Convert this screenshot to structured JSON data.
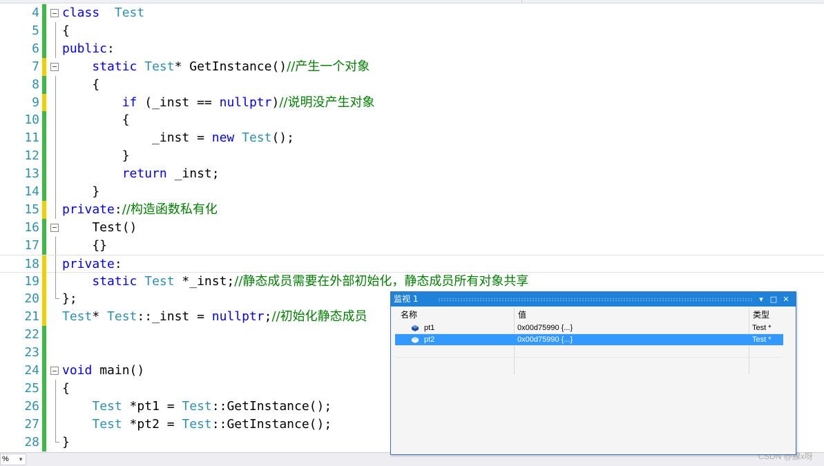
{
  "editor": {
    "lines": [
      {
        "n": "4",
        "bar": "green",
        "fold": true,
        "segs": [
          [
            "kw",
            "class"
          ],
          [
            "",
            "  "
          ],
          [
            "ty",
            "Test"
          ]
        ]
      },
      {
        "n": "5",
        "bar": "green",
        "guide": true,
        "segs": [
          [
            "",
            "{"
          ]
        ]
      },
      {
        "n": "6",
        "bar": "green",
        "guide": true,
        "segs": [
          [
            "kw",
            "public"
          ],
          [
            "",
            ":"
          ]
        ]
      },
      {
        "n": "7",
        "bar": "yellow",
        "fold": true,
        "segs": [
          [
            "",
            "    "
          ],
          [
            "kw",
            "static"
          ],
          [
            "",
            ""
          ],
          [
            "ty",
            " Test"
          ],
          [
            "",
            "* GetInstance()"
          ],
          [
            "cm",
            "//产生一个对象"
          ]
        ]
      },
      {
        "n": "8",
        "bar": "green",
        "guide": true,
        "segs": [
          [
            "",
            "    {"
          ]
        ]
      },
      {
        "n": "9",
        "bar": "yellow",
        "guide": true,
        "segs": [
          [
            "",
            "        "
          ],
          [
            "kw",
            "if"
          ],
          [
            "",
            " (_inst == "
          ],
          [
            "kw",
            "nullptr"
          ],
          [
            "",
            ")"
          ],
          [
            "cm",
            "//说明没产生对象"
          ]
        ]
      },
      {
        "n": "10",
        "bar": "green",
        "guide": true,
        "segs": [
          [
            "",
            "        {"
          ]
        ]
      },
      {
        "n": "11",
        "bar": "green",
        "guide": true,
        "segs": [
          [
            "",
            "            _inst = "
          ],
          [
            "kw",
            "new"
          ],
          [
            "ty",
            " Test"
          ],
          [
            "",
            "();"
          ]
        ]
      },
      {
        "n": "12",
        "bar": "green",
        "guide": true,
        "segs": [
          [
            "",
            "        }"
          ]
        ]
      },
      {
        "n": "13",
        "bar": "green",
        "guide": true,
        "segs": [
          [
            "",
            "        "
          ],
          [
            "kw",
            "return"
          ],
          [
            "",
            " _inst;"
          ]
        ]
      },
      {
        "n": "14",
        "bar": "green",
        "guide": true,
        "segs": [
          [
            "",
            "    }"
          ]
        ]
      },
      {
        "n": "15",
        "bar": "yellow",
        "guide": true,
        "segs": [
          [
            "kw",
            "private"
          ],
          [
            "",
            ":"
          ],
          [
            "cm",
            "//构造函数私有化"
          ]
        ]
      },
      {
        "n": "16",
        "bar": "green",
        "fold": true,
        "segs": [
          [
            "",
            "    Test()"
          ]
        ]
      },
      {
        "n": "17",
        "bar": "green",
        "guide": true,
        "segs": [
          [
            "",
            "    {}"
          ]
        ]
      },
      {
        "n": "18",
        "bar": "yellow",
        "guide": true,
        "current": true,
        "segs": [
          [
            "kw",
            "private"
          ],
          [
            "",
            ":"
          ]
        ]
      },
      {
        "n": "19",
        "bar": "yellow",
        "guide": true,
        "segs": [
          [
            "",
            "    "
          ],
          [
            "kw",
            "static"
          ],
          [
            "ty",
            " Test"
          ],
          [
            "",
            " *_inst;"
          ],
          [
            "cm",
            "//静态成员需要在外部初始化，静态成员所有对象共享"
          ]
        ]
      },
      {
        "n": "20",
        "bar": "yellow",
        "guideEnd": true,
        "segs": [
          [
            "",
            "};"
          ]
        ]
      },
      {
        "n": "21",
        "bar": "yellow",
        "segs": [
          [
            "ty",
            "Test"
          ],
          [
            "",
            "* "
          ],
          [
            "ty",
            "Test"
          ],
          [
            "",
            "::_inst = "
          ],
          [
            "kw",
            "nullptr"
          ],
          [
            "",
            ";"
          ],
          [
            "cm",
            "//初始化静态成员"
          ]
        ]
      },
      {
        "n": "22",
        "bar": "green",
        "segs": []
      },
      {
        "n": "23",
        "bar": "green",
        "segs": []
      },
      {
        "n": "24",
        "bar": "green",
        "fold": true,
        "segs": [
          [
            "kw",
            "void"
          ],
          [
            "",
            " main()"
          ]
        ]
      },
      {
        "n": "25",
        "bar": "green",
        "guide": true,
        "segs": [
          [
            "",
            "{"
          ]
        ]
      },
      {
        "n": "26",
        "bar": "green",
        "guide": true,
        "segs": [
          [
            "",
            "    "
          ],
          [
            "ty",
            "Test"
          ],
          [
            "",
            " *pt1 = "
          ],
          [
            "ty",
            "Test"
          ],
          [
            "",
            "::GetInstance();"
          ]
        ]
      },
      {
        "n": "27",
        "bar": "green",
        "guide": true,
        "segs": [
          [
            "",
            "    "
          ],
          [
            "ty",
            "Test"
          ],
          [
            "",
            " *pt2 = "
          ],
          [
            "ty",
            "Test"
          ],
          [
            "",
            "::GetInstance();"
          ]
        ]
      },
      {
        "n": "28",
        "bar": "green",
        "guideEnd": true,
        "segs": [
          [
            "",
            "}"
          ]
        ]
      }
    ]
  },
  "status": {
    "zoom": "%",
    "zoom_arrow": "▼"
  },
  "watermark": "CSDN @腺x呀",
  "watch": {
    "title": "监视 1",
    "buttons": {
      "dropdown": "▾",
      "maximize": "□",
      "close": "✕"
    },
    "columns": {
      "name": "名称",
      "value": "值",
      "type": "类型"
    },
    "rows": [
      {
        "name": "pt1",
        "value": "0x00d75990 {...}",
        "type": "Test *",
        "selected": false
      },
      {
        "name": "pt2",
        "value": "0x00d75990 {...}",
        "type": "Test *",
        "selected": true
      }
    ]
  },
  "colors": {
    "keyword": "#0000ff",
    "type": "#2b91af",
    "comment": "#008000",
    "selection": "#3399ff",
    "title_bar": "#1e82d8"
  }
}
